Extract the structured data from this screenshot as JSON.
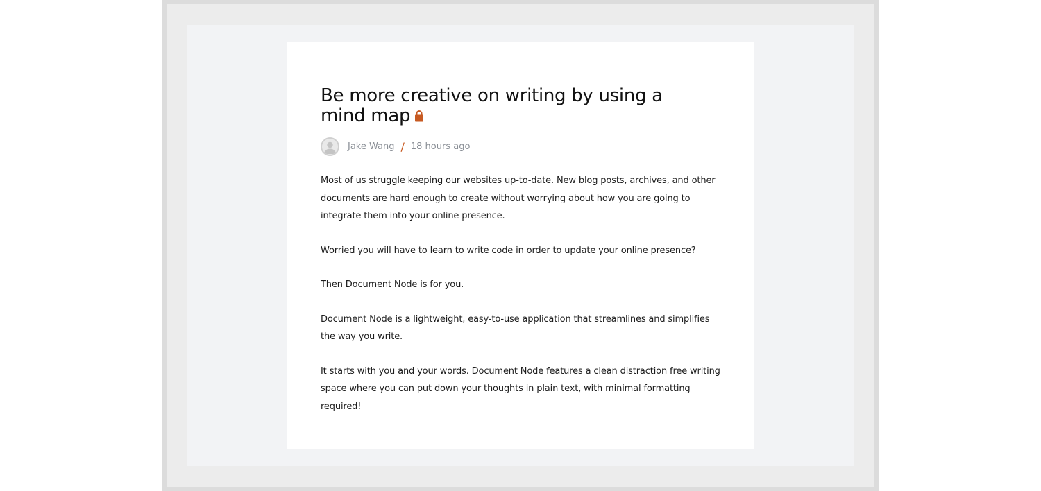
{
  "post": {
    "title": "Be more creative on writing by using a mind map",
    "locked_icon": "lock-icon",
    "author": "Jake Wang",
    "separator": "/",
    "time": "18 hours ago",
    "paragraphs": [
      "Most of us struggle keeping our websites up-to-date. New blog posts, archives, and other documents are hard enough to create without worrying about how you are going to integrate them into your online presence.",
      "Worried you will have to learn to write code in order to update your online presence?",
      "Then Document Node is for you.",
      "Document Node is a lightweight, easy-to-use application that streamlines and simplifies the way you write.",
      "It starts with you and your words. Document Node features a clean distraction free writing space where you can put down your thoughts in plain text, with minimal formatting required!"
    ]
  },
  "colors": {
    "accent": "#c75a22",
    "meta_text": "#8a8f96",
    "page_bg": "#f2f3f5"
  }
}
